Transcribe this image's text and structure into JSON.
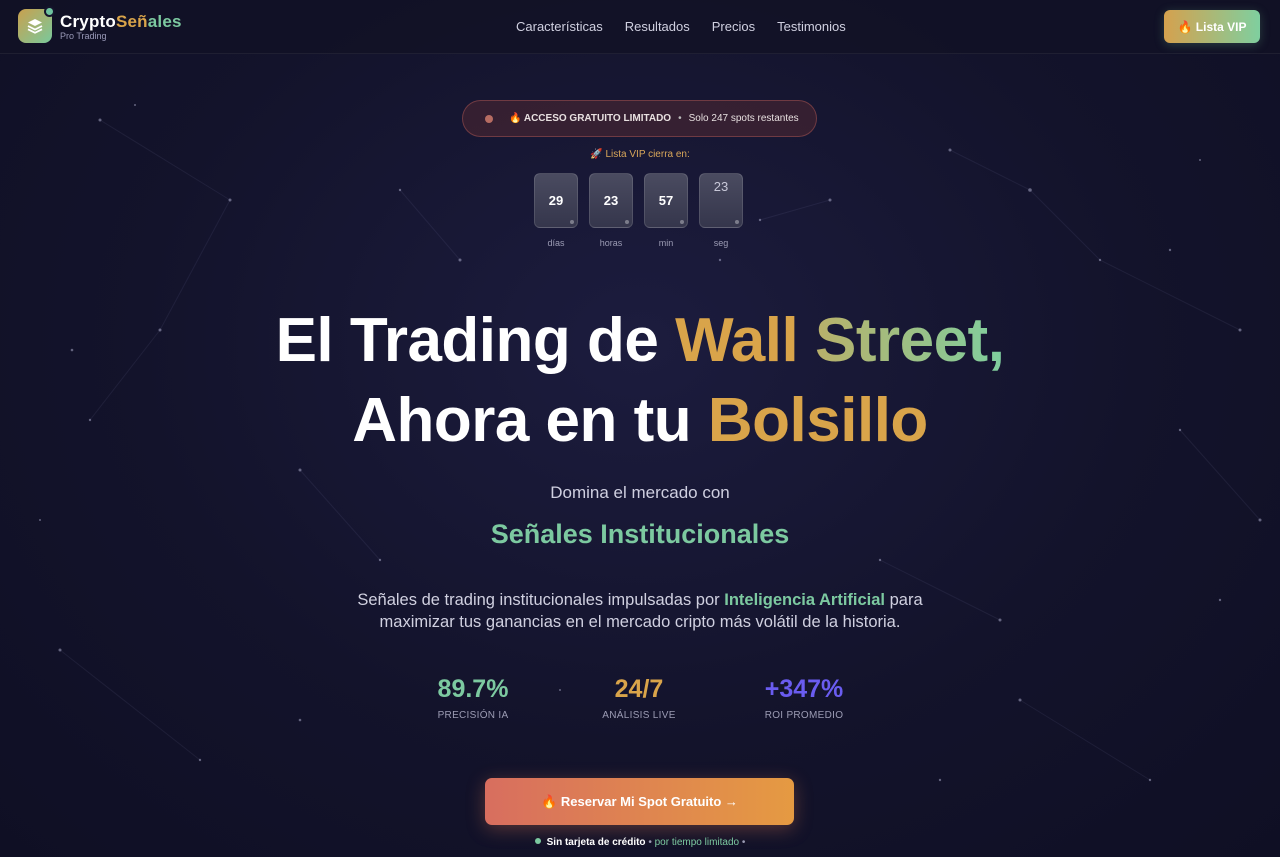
{
  "nav": {
    "brand_part1": "Crypto",
    "brand_part2": "Señ",
    "brand_part3": "ales",
    "brand_sub": "Pro Trading",
    "links": [
      "Características",
      "Resultados",
      "Precios",
      "Testimonios"
    ],
    "vip_button": "🔥 Lista VIP"
  },
  "badge": {
    "title": "🔥 ACCESO GRATUITO LIMITADO",
    "separator": "•",
    "spots": "Solo 247 spots restantes"
  },
  "countdown": {
    "heading": "🚀 Lista VIP cierra en:",
    "units": [
      {
        "value": "29",
        "label": "días"
      },
      {
        "value": "23",
        "label": "horas"
      },
      {
        "value": "57",
        "label": "min"
      },
      {
        "value": "23",
        "label": "seg"
      }
    ]
  },
  "hero": {
    "line1_a": "El Trading de ",
    "line1_b": "Wall ",
    "line1_c": "Street,",
    "line2_a": "Ahora en tu ",
    "line2_b": "Bolsillo",
    "subtitle": "Domina el mercado con",
    "highlight": "Señales Institucionales",
    "desc_a": "Señales de trading institucionales impulsadas por ",
    "desc_b": "Inteligencia Artificial",
    "desc_c": " para",
    "desc_line2": "maximizar tus ganancias en el mercado cripto más volátil de la historia."
  },
  "stats": [
    {
      "value": "89.7%",
      "label": "PRECISIÓN IA",
      "color": "#7cc9a0"
    },
    {
      "value": "24/7",
      "label": "ANÁLISIS LIVE",
      "color": "#d9a44a"
    },
    {
      "value": "+347%",
      "label": "ROI PROMEDIO",
      "color": "#6a5cf0"
    }
  ],
  "cta": {
    "label": "🔥 Reservar Mi Spot Gratuito →"
  },
  "footnote": {
    "bold": "Sin tarjeta de crédito",
    "mid": " • ",
    "green": "por tiempo limitado",
    "end": " •"
  }
}
